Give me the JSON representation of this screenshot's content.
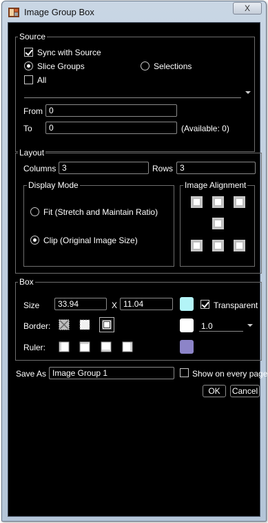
{
  "window": {
    "title": "Image Group Box",
    "close_glyph": "X"
  },
  "source": {
    "label": "Source",
    "sync_label": "Sync with Source",
    "sync_checked": true,
    "slice_groups_label": "Slice Groups",
    "selections_label": "Selections",
    "selected_mode": "Slice Groups",
    "all_label": "All",
    "all_checked": false,
    "from_label": "From",
    "from_value": "0",
    "to_label": "To",
    "to_value": "0",
    "available_text": "(Available: 0)"
  },
  "layout": {
    "label": "Layout",
    "columns_label": "Columns",
    "columns_value": "3",
    "rows_label": "Rows",
    "rows_value": "3",
    "display_mode_label": "Display Mode",
    "fit_label": "Fit (Stretch and Maintain Ratio)",
    "clip_label": "Clip (Original Image Size)",
    "selected_display_mode": "Clip (Original Image Size)",
    "image_alignment_label": "Image Alignment"
  },
  "box": {
    "label": "Box",
    "size_label": "Size",
    "width_value": "33.94",
    "x_label": "X",
    "height_value": "11.04",
    "transparent_label": "Transparent",
    "transparent_checked": true,
    "border_label": "Border:",
    "border_width_value": "1.0",
    "ruler_label": "Ruler:",
    "colors": {
      "size_swatch": "#b3f4f7",
      "border_swatch": "#ffffff",
      "ruler_swatch": "#8c84c8"
    }
  },
  "footer": {
    "save_as_label": "Save As",
    "save_as_value": "Image Group 1",
    "show_every_page_label": "Show on every page",
    "show_every_page_checked": false,
    "ok_label": "OK",
    "cancel_label": "Cancel"
  }
}
